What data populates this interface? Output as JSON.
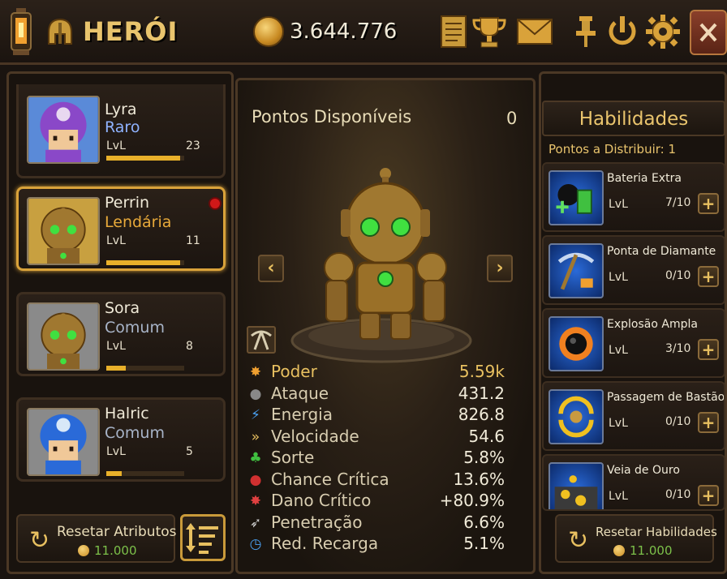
{
  "header": {
    "title": "HERÓI",
    "gold": "3.644.776"
  },
  "heroes": [
    {
      "name": "Lyra",
      "rarity": "Raro",
      "rarity_color": "#8fb3ff",
      "lvl_label": "LvL",
      "level": "23",
      "progress": 0.95
    },
    {
      "name": "Perrin",
      "rarity": "Lendária",
      "rarity_color": "#e8a93a",
      "lvl_label": "LvL",
      "level": "11",
      "progress": 0.95
    },
    {
      "name": "Sora",
      "rarity": "Comum",
      "rarity_color": "#a8b4c8",
      "lvl_label": "LvL",
      "level": "8",
      "progress": 0.25
    },
    {
      "name": "Halric",
      "rarity": "Comum",
      "rarity_color": "#a8b4c8",
      "lvl_label": "LvL",
      "level": "5",
      "progress": 0.2
    }
  ],
  "left_footer": {
    "reset_label": "Resetar Atributos",
    "reset_cost": "11.000"
  },
  "center": {
    "points_label": "Pontos Disponíveis",
    "points_value": "0",
    "stats": [
      {
        "name": "Poder",
        "value": "5.59k",
        "icon": "burst-icon",
        "highlight": true
      },
      {
        "name": "Ataque",
        "value": "431.2",
        "icon": "bomb-icon"
      },
      {
        "name": "Energia",
        "value": "826.8",
        "icon": "lightning-icon"
      },
      {
        "name": "Velocidade",
        "value": "54.6",
        "icon": "wing-icon"
      },
      {
        "name": "Sorte",
        "value": "5.8%",
        "icon": "clover-icon"
      },
      {
        "name": "Chance Crítica",
        "value": "13.6%",
        "icon": "crit-bomb-icon"
      },
      {
        "name": "Dano Crítico",
        "value": "+80.9%",
        "icon": "crit-burst-icon"
      },
      {
        "name": "Penetração",
        "value": "6.6%",
        "icon": "drill-icon"
      },
      {
        "name": "Red. Recarga",
        "value": "5.1%",
        "icon": "cooldown-icon"
      }
    ]
  },
  "right": {
    "title": "Habilidades",
    "points_to_distribute": "Pontos a Distribuir: 1",
    "skills": [
      {
        "name": "Bateria Extra",
        "lvl_label": "LvL",
        "count": "7/10",
        "icon": "battery-bomb-icon"
      },
      {
        "name": "Ponta de Diamante",
        "lvl_label": "LvL",
        "count": "0/10",
        "icon": "pickaxe-icon"
      },
      {
        "name": "Explosão Ampla",
        "lvl_label": "LvL",
        "count": "3/10",
        "icon": "explosion-icon"
      },
      {
        "name": "Passagem de Bastão",
        "lvl_label": "LvL",
        "count": "0/10",
        "icon": "relay-icon"
      },
      {
        "name": "Veia de Ouro",
        "lvl_label": "LvL",
        "count": "0/10",
        "icon": "gold-vein-icon"
      }
    ],
    "reset_label": "Resetar Habilidades",
    "reset_cost": "11.000"
  }
}
